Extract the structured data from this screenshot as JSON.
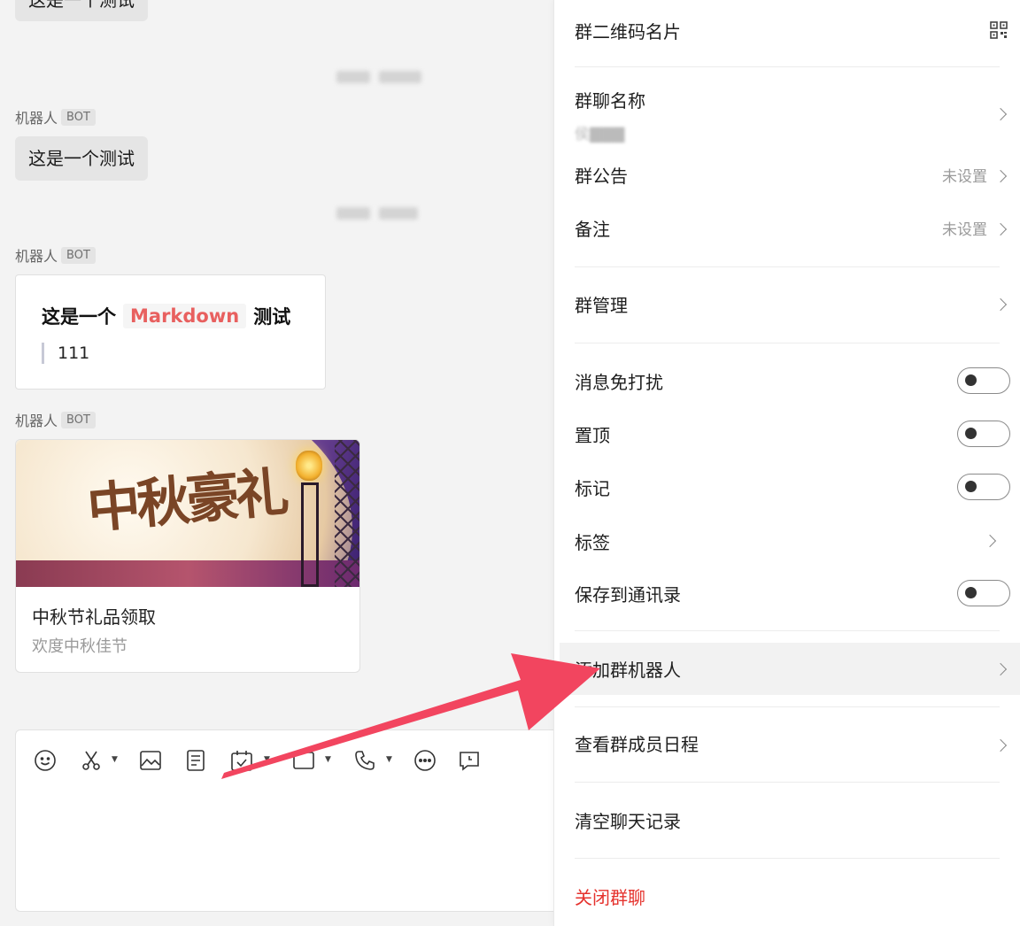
{
  "chat": {
    "messages": [
      {
        "sender": "机器人",
        "badge": "BOT",
        "text": "这是一个测试"
      },
      {
        "sender": "机器人",
        "badge": "BOT",
        "markdown": {
          "before": "这是一个",
          "code": "Markdown",
          "after": "测试",
          "quote": "111"
        }
      },
      {
        "sender": "机器人",
        "badge": "BOT",
        "news": {
          "image_text": "中秋豪礼",
          "title": "中秋节礼品领取",
          "description": "欢度中秋佳节"
        }
      }
    ],
    "top_partial_text": "这是一个测试"
  },
  "toolbar": {
    "icons": [
      "emoji-icon",
      "scissors-icon",
      "image-icon",
      "document-icon",
      "calendar-check-icon",
      "monitor-icon",
      "phone-icon",
      "more-icon",
      "chat-bubble-clock-icon"
    ]
  },
  "panel": {
    "qr_label": "群二维码名片",
    "group_name_label": "群聊名称",
    "group_announcement_label": "群公告",
    "group_announcement_value": "未设置",
    "remark_label": "备注",
    "remark_value": "未设置",
    "group_manage_label": "群管理",
    "mute_label": "消息免打扰",
    "pin_label": "置顶",
    "mark_label": "标记",
    "tag_label": "标签",
    "save_contacts_label": "保存到通讯录",
    "add_bot_label": "添加群机器人",
    "member_schedule_label": "查看群成员日程",
    "clear_history_label": "清空聊天记录",
    "close_group_label": "关闭群聊",
    "toggles": {
      "mute": false,
      "pin": false,
      "mark": false,
      "save_contacts": false
    }
  },
  "colors": {
    "danger": "#e5322d",
    "markdown_code": "#e8605f",
    "arrow": "#f2455f",
    "highlight_row": "#f2f2f2"
  }
}
